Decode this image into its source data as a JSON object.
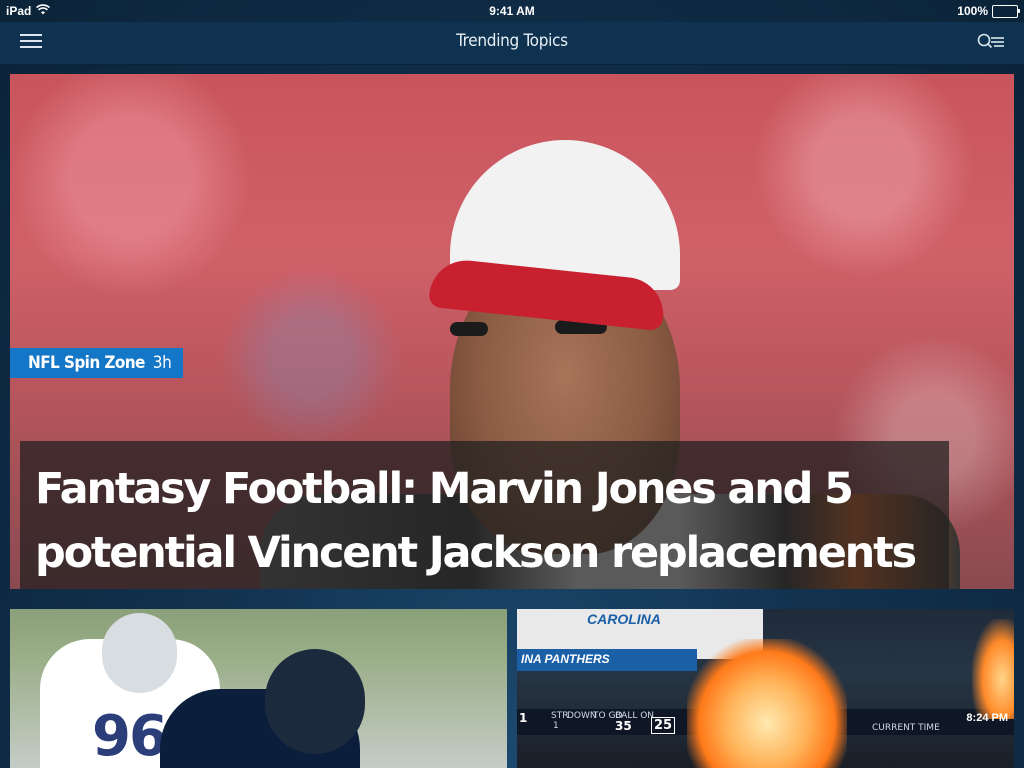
{
  "status_bar": {
    "device": "iPad",
    "time": "9:41 AM",
    "battery": "100%"
  },
  "nav": {
    "title": "Trending Topics",
    "menu_icon": "hamburger-menu-icon",
    "search_icon": "search-list-icon"
  },
  "hero": {
    "source": "NFL Spin Zone",
    "age": "3h",
    "headline": "Fantasy Football: Marvin Jones and 5 potential Vincent Jackson replacements",
    "accent_color": "#1476c6"
  },
  "tiles": [
    {
      "jersey_number": "96"
    },
    {
      "stadium_sign": "CAROLINA",
      "banner": "INA PANTHERS",
      "scoreboard": {
        "quarter": "1",
        "down_label": "STR",
        "down_value": "1",
        "col_down": "DOWN",
        "col_togo": "TO GO",
        "col_ballon": "BALL ON",
        "ballon_value": "35",
        "playclock": "25",
        "time_label": "CURRENT TIME",
        "time_value": "8:24 PM"
      }
    }
  ]
}
